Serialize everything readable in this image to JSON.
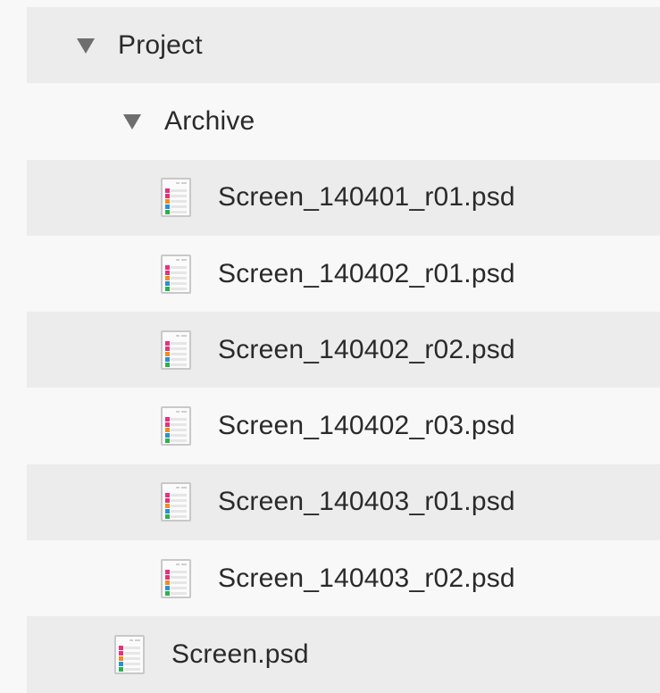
{
  "tree": {
    "project": {
      "label": "Project",
      "expanded": true,
      "children": {
        "archive": {
          "label": "Archive",
          "expanded": true,
          "files": [
            {
              "name": "Screen_140401_r01.psd"
            },
            {
              "name": "Screen_140402_r01.psd"
            },
            {
              "name": "Screen_140402_r02.psd"
            },
            {
              "name": "Screen_140402_r03.psd"
            },
            {
              "name": "Screen_140403_r01.psd"
            },
            {
              "name": "Screen_140403_r02.psd"
            }
          ]
        },
        "files": [
          {
            "name": "Screen.psd"
          }
        ]
      }
    }
  },
  "icons": {
    "disclosure": "triangle-down-icon",
    "file": "psd-file-icon"
  },
  "colors": {
    "row_alt": "#ececec",
    "row_base": "#f8f8f8",
    "text": "#2a2a2a",
    "disclosure": "#6e6e6e",
    "icon_bar_pink": "#e6327a",
    "icon_bar_orange": "#f28c1e",
    "icon_bar_blue": "#2a8fd6",
    "icon_bar_green": "#2bb24c"
  }
}
